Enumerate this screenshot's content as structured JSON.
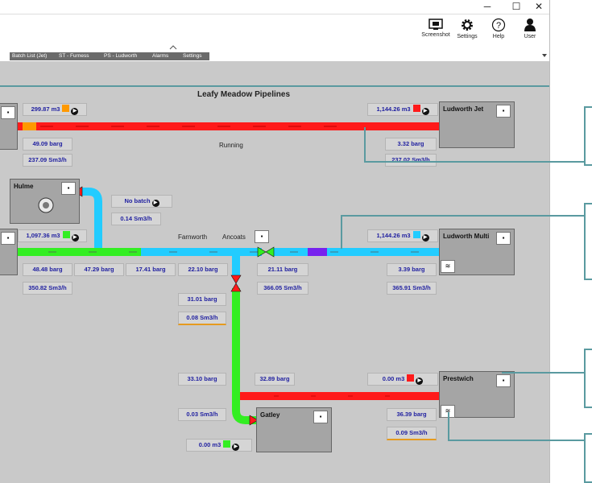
{
  "titlebar": {
    "minimize": "─",
    "maximize": "☐",
    "close": "✕"
  },
  "toolbar": {
    "screenshot": "Screenshot",
    "settings": "Settings",
    "help": "Help",
    "user": "User"
  },
  "tabs": [
    "Batch List (Jet)",
    "ST - Furness",
    "PS - Ludworth",
    "Alarms",
    "Settings"
  ],
  "diagram": {
    "title": "Leafy Meadow Pipelines",
    "status_running": "Running",
    "labels": {
      "farnworth": "Farnworth",
      "ancoats": "Ancoats"
    },
    "stations": {
      "ludworth_jet": "Ludworth Jet",
      "hulme": "Hulme",
      "ludworth_multi": "Ludworth Multi",
      "prestwich": "Prestwich",
      "gatley": "Gatley"
    },
    "values": {
      "top_left_volume": "299.87 m3",
      "top_left_pressure": "49.09 barg",
      "top_left_flow": "237.09 Sm3/h",
      "ludworth_jet_volume": "1,144.26 m3",
      "ludworth_jet_pressure": "3.32 barg",
      "ludworth_jet_flow": "237.02 Sm3/h",
      "hulme_batch": "No batch",
      "hulme_flow": "0.14 Sm3/h",
      "mid_left_volume": "1,097.36 m3",
      "mid_left_pressure": "48.48 barg",
      "mid_left_flow": "350.82 Sm3/h",
      "p2": "47.29 barg",
      "p3": "17.41 barg",
      "p4": "22.10 barg",
      "ancoats_pressure": "21.11 barg",
      "ancoats_flow": "366.05 Sm3/h",
      "ludworth_multi_volume": "1,144.26 m3",
      "ludworth_multi_pressure": "3.39 barg",
      "ludworth_multi_flow": "365.91 Sm3/h",
      "v_pressure": "31.01 barg",
      "v_flow": "0.08 Sm3/h",
      "gatley_in_pressure": "33.10 barg",
      "gatley_flow": "0.03 Sm3/h",
      "gatley_volume": "0.00 m3",
      "bottom_pressure": "32.89 barg",
      "prestwich_volume": "0.00 m3",
      "prestwich_pressure": "36.39 barg",
      "prestwich_flow": "0.09 Sm3/h"
    }
  },
  "colors": {
    "pipe_red": "#ff1a1a",
    "pipe_green": "#33ee22",
    "pipe_cyan": "#22ccff",
    "batch_orange": "#ff9900",
    "batch_purple": "#7722ee",
    "background": "#c9c9c9",
    "callout": "#5a9aa0"
  },
  "icons": [
    "minimize-icon",
    "maximize-icon",
    "close-icon",
    "screenshot-icon",
    "gear-icon",
    "help-icon",
    "user-icon",
    "play-icon",
    "valve-icon",
    "pump-icon",
    "tank-icon"
  ]
}
